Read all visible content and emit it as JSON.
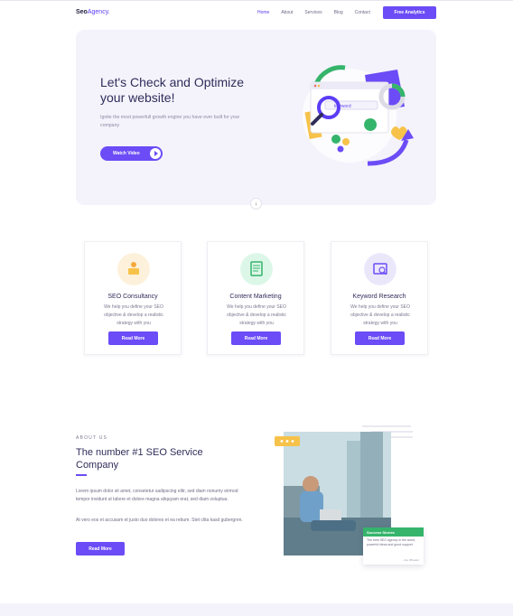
{
  "header": {
    "logo_main": "Seo",
    "logo_accent": "Agency.",
    "nav": [
      "Home",
      "About",
      "Services",
      "Blog",
      "Contact"
    ],
    "cta_label": "Free Analytics"
  },
  "hero": {
    "title": "Let's Check and Optimize your website!",
    "subtitle": "Ignite the most powerfull growth engine you have ever built for your company",
    "watch_label": "Watch Video",
    "search_word": "keyword",
    "scroll_icon": "↓"
  },
  "services": [
    {
      "title": "SEO Consultancy",
      "desc": "We help you define your SEO objective & develop a realistic strategy with you",
      "button": "Read More",
      "icon": "consultancy-icon",
      "icon_bg": "#fdf1dc"
    },
    {
      "title": "Content Marketing",
      "desc": "We help you define your SEO objective & develop a realistic strategy with you",
      "button": "Read More",
      "icon": "content-icon",
      "icon_bg": "#dcf7e8"
    },
    {
      "title": "Keyword Research",
      "desc": "We help you define your SEO objective & develop a realistic strategy with you",
      "button": "Read More",
      "icon": "keyword-icon",
      "icon_bg": "#ebe7fb"
    }
  ],
  "about": {
    "kicker": "ABOUT US",
    "title": "The number #1 SEO Service Company",
    "para1": "Lorem ipsum dolor sit amet, consetetur sadipscing elitr, sed diam nonumy eirmod tempor invidunt ut labore et dolore magna aliquyam erat, sed diam voluptua.",
    "para2": "At vero eos et accusam et justo duo dolores et ea rebum. Stet clita kasd gubergren.",
    "button": "Read More",
    "success_title": "Success Stories",
    "success_text": "The best SEO agency in the world, powerful ideas and good support",
    "success_author": "- Joe Wheeler"
  },
  "colors": {
    "accent": "#6b4cf6",
    "green": "#35b46b",
    "yellow": "#f7c24a"
  }
}
